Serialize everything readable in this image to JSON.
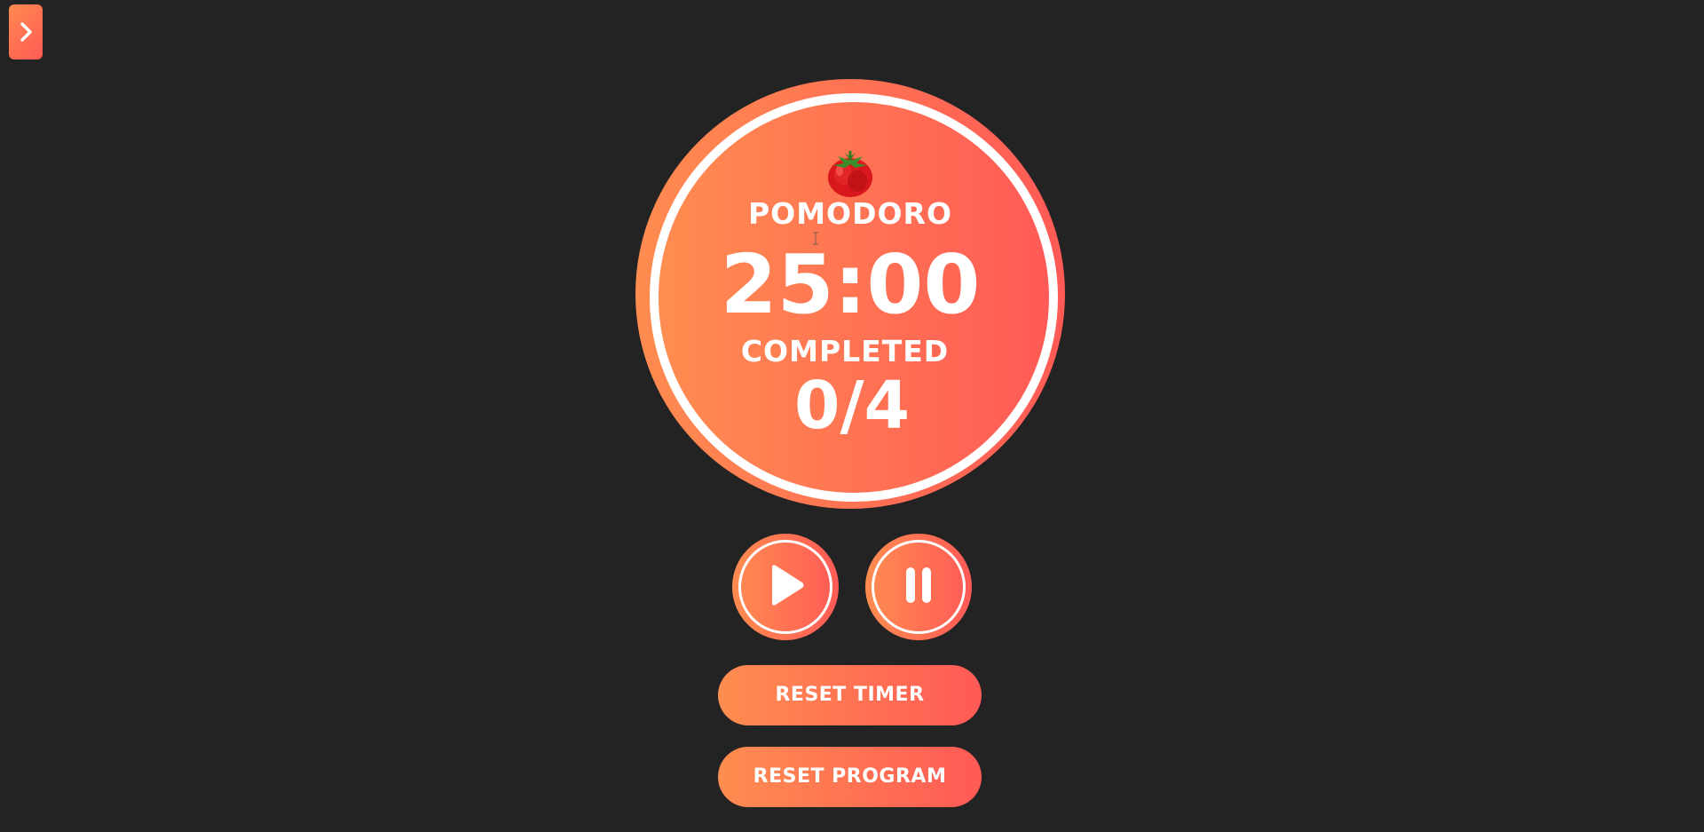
{
  "sidebar": {
    "toggle_icon": "chevron-right-icon"
  },
  "timer": {
    "mode_label": "POMODORO",
    "time": "25:00",
    "completed_label": "COMPLETED",
    "completed_value": "0/4",
    "mode_icon": "tomato-icon"
  },
  "controls": {
    "play_icon": "play-icon",
    "pause_icon": "pause-icon",
    "reset_timer_label": "RESET TIMER",
    "reset_program_label": "RESET PROGRAM"
  },
  "colors": {
    "background": "#232323",
    "accent_start": "#ff8c50",
    "accent_end": "#ff5a56",
    "text": "#ffffff"
  }
}
